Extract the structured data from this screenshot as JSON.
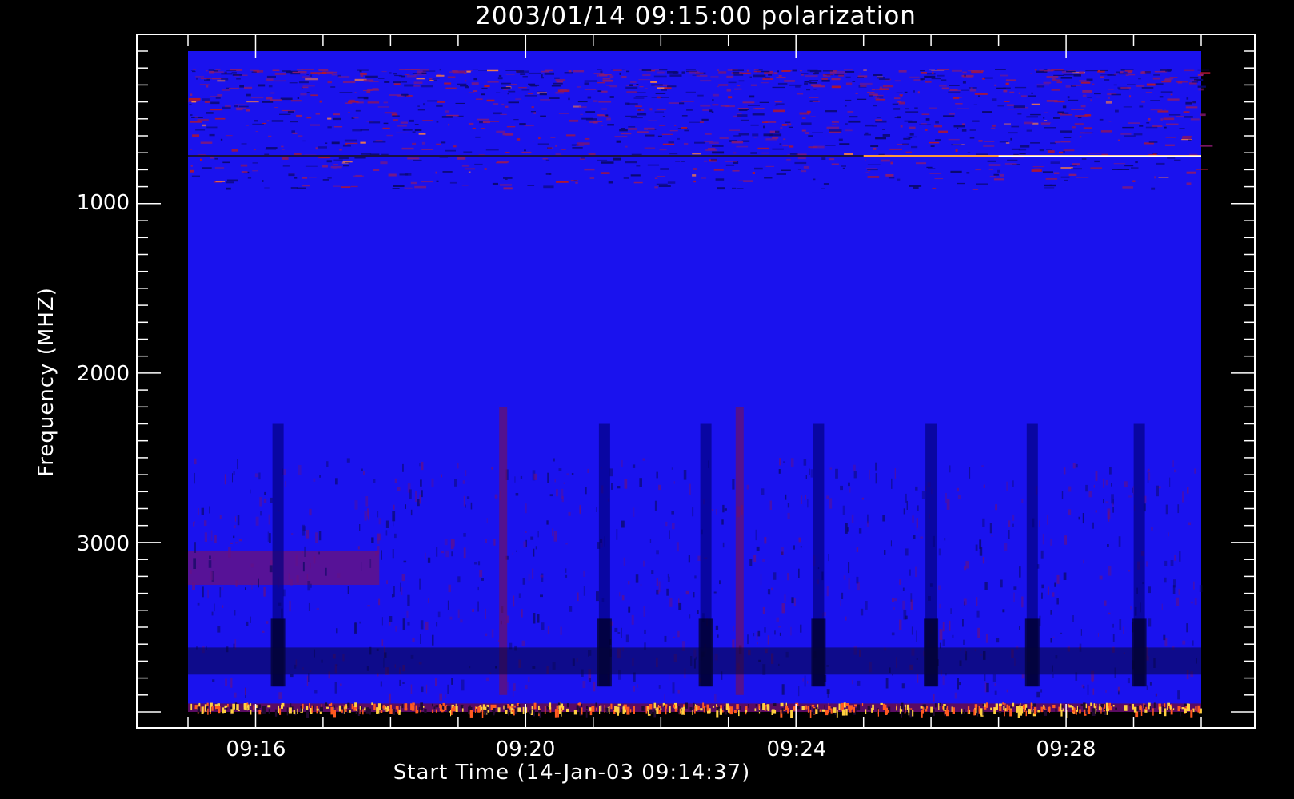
{
  "chart_data": {
    "type": "heatmap",
    "title": "2003/01/14 09:15:00 polarization",
    "xlabel": "Start Time (14-Jan-03 09:14:37)",
    "ylabel": "Frequency (MHZ)",
    "x_axis": {
      "unit": "time",
      "range": [
        "09:15:00",
        "09:30:00"
      ],
      "tick_labels": [
        "09:16",
        "09:20",
        "09:24",
        "09:28"
      ]
    },
    "y_axis": {
      "unit": "MHz",
      "inverted": true,
      "range": [
        100,
        4000
      ],
      "tick_labels": [
        "1000",
        "2000",
        "3000"
      ]
    },
    "colors": {
      "background_blue": "#1a12ee",
      "red_feature": "#b01630",
      "bright": "#ffd040",
      "dark": "#00001c"
    },
    "features": {
      "bright_line_freq_mhz": 720,
      "dark_vertical_stripes_at": [
        "09:16:20",
        "09:21:10",
        "09:22:40",
        "09:24:20",
        "09:26:00",
        "09:27:30",
        "09:29:05"
      ],
      "red_vertical_stripes_at": [
        "09:19:40",
        "09:23:10"
      ],
      "red_patch_freq_mhz": [
        3050,
        3250
      ]
    }
  }
}
